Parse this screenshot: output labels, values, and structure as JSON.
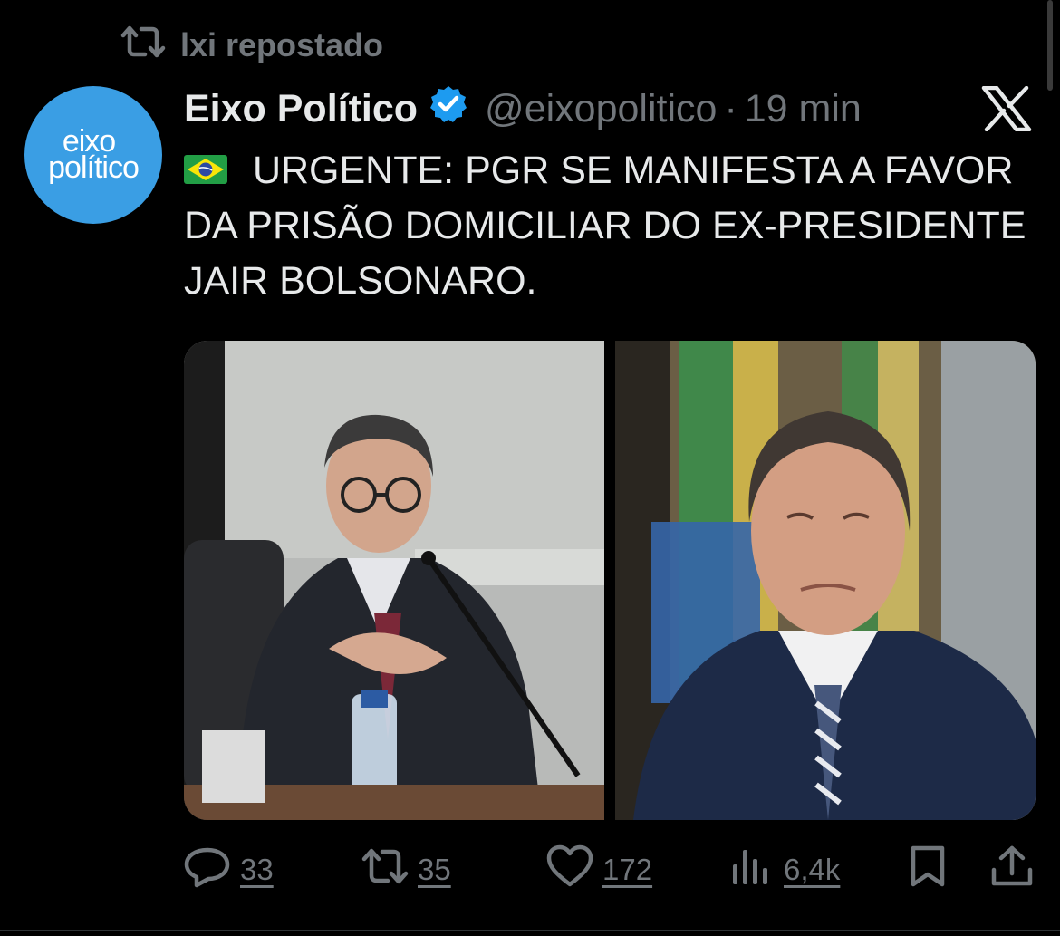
{
  "repost": {
    "text": "lxi repostado",
    "icon": "repost-icon"
  },
  "author": {
    "avatar_line1": "eixo",
    "avatar_line2": "político",
    "avatar_color": "#3a9ee4",
    "name": "Eixo Político",
    "verified_icon": "verified-badge-icon",
    "handle": "@eixopolitico",
    "separator": "·",
    "time": "19 min"
  },
  "menu": {
    "icon": "x-logo-icon"
  },
  "tweet": {
    "flag_icon": "brazil-flag-icon",
    "text": "URGENTE: PGR SE MANIFESTA A FAVOR DA PRISÃO DOMICILIAR DO EX-PRESIDENTE JAIR BOLSONARO."
  },
  "media": {
    "left_icon": "photo-man-glasses-at-desk",
    "right_icon": "photo-man-suit-flag-background"
  },
  "actions": {
    "replies": {
      "icon": "reply-icon",
      "count": "33"
    },
    "reposts": {
      "icon": "repost-icon",
      "count": "35"
    },
    "likes": {
      "icon": "heart-icon",
      "count": "172"
    },
    "views": {
      "icon": "views-chart-icon",
      "count": "6,4k"
    },
    "bookmark": {
      "icon": "bookmark-icon"
    },
    "share": {
      "icon": "share-icon"
    }
  },
  "colors": {
    "background": "#000000",
    "text": "#e7e9ea",
    "muted": "#71767b",
    "verified": "#1d9bf0"
  }
}
